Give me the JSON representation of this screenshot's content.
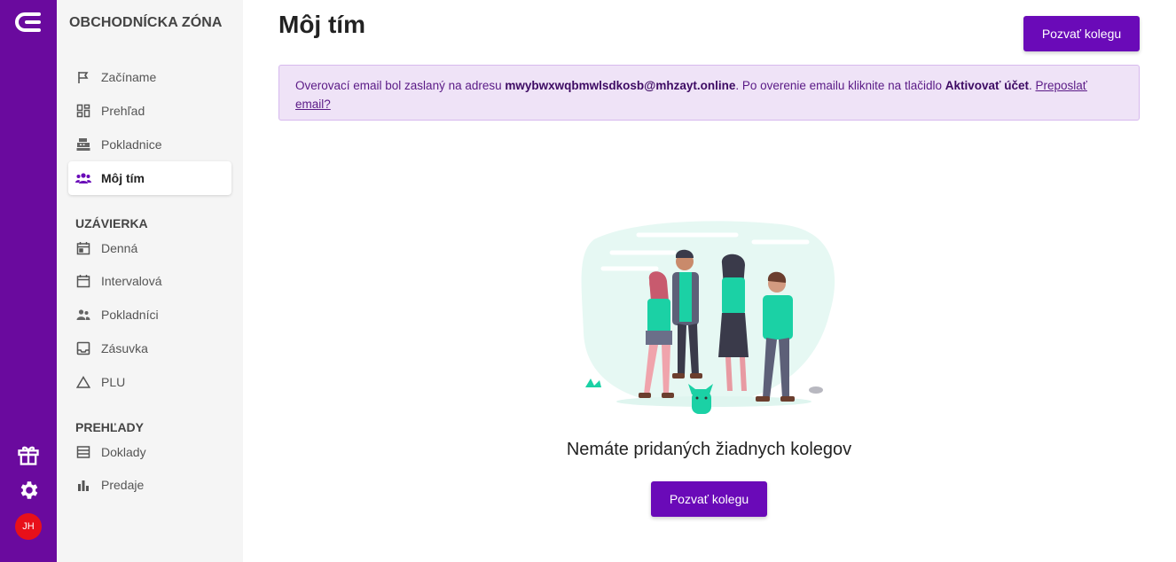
{
  "sidebar": {
    "title": "OBCHODNÍCKA ZÓNA",
    "items_top": [
      {
        "label": "Začíname",
        "icon": "flag-icon"
      },
      {
        "label": "Prehľad",
        "icon": "dashboard-icon"
      },
      {
        "label": "Pokladnice",
        "icon": "cash-register-icon"
      },
      {
        "label": "Môj tím",
        "icon": "team-icon",
        "active": true
      }
    ],
    "section_uzavierka": "UZÁVIERKA",
    "items_uzavierka": [
      {
        "label": "Denná",
        "icon": "calendar-day-icon"
      },
      {
        "label": "Intervalová",
        "icon": "calendar-range-icon"
      },
      {
        "label": "Pokladníci",
        "icon": "cashiers-icon"
      },
      {
        "label": "Zásuvka",
        "icon": "drawer-icon"
      },
      {
        "label": "PLU",
        "icon": "triangle-icon"
      }
    ],
    "section_prehlady": "PREHĽADY",
    "items_prehlady": [
      {
        "label": "Doklady",
        "icon": "receipts-icon"
      },
      {
        "label": "Predaje",
        "icon": "bar-chart-icon"
      }
    ]
  },
  "rail": {
    "avatar_initials": "JH"
  },
  "main": {
    "title": "Môj tím",
    "invite_button": "Pozvať kolegu",
    "alert": {
      "text_before": "Overovací email bol zaslaný na adresu ",
      "email": "mwybwxwqbmwlsdkosb@mhzayt.online",
      "text_middle": ". Po overenie emailu kliknite na tlačidlo ",
      "action": "Aktivovať účet",
      "text_after": ". ",
      "resend_link": "Preposlať email?"
    },
    "empty_message": "Nemáte pridaných žiadnych kolegov",
    "empty_button": "Pozvať kolegu"
  },
  "colors": {
    "brand": "#6a0a9e",
    "button": "#6a0ab8",
    "alert_bg": "#efe3f7",
    "avatar": "#e8101a",
    "illustration_accent": "#1bd1a5"
  }
}
